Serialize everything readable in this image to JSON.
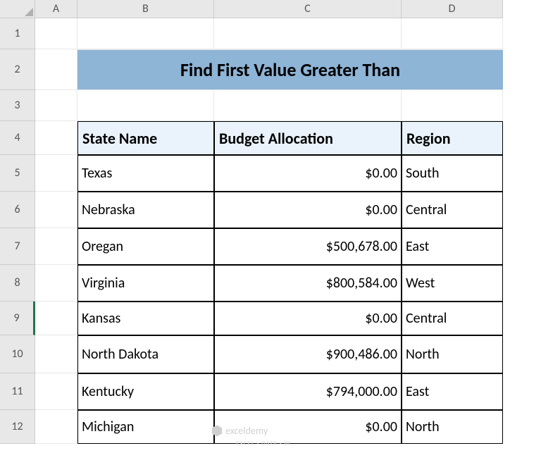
{
  "columns": [
    "A",
    "B",
    "C",
    "D"
  ],
  "rows": [
    "1",
    "2",
    "3",
    "4",
    "5",
    "6",
    "7",
    "8",
    "9",
    "10",
    "11",
    "12"
  ],
  "title": "Find First Value Greater Than",
  "headers": {
    "state": "State Name",
    "budget": "Budget Allocation",
    "region": "Region"
  },
  "data": [
    {
      "state": "Texas",
      "budget": "$0.00",
      "region": "South"
    },
    {
      "state": "Nebraska",
      "budget": "$0.00",
      "region": "Central"
    },
    {
      "state": "Oregan",
      "budget": "$500,678.00",
      "region": "East"
    },
    {
      "state": "Virginia",
      "budget": "$800,584.00",
      "region": "West"
    },
    {
      "state": "Kansas",
      "budget": "$0.00",
      "region": "Central"
    },
    {
      "state": "North Dakota",
      "budget": "$900,486.00",
      "region": "North"
    },
    {
      "state": "Kentucky",
      "budget": "$794,000.00",
      "region": "East"
    },
    {
      "state": "Michigan",
      "budget": "$0.00",
      "region": "North"
    }
  ],
  "watermark": {
    "name": "exceldemy",
    "tag": "EXCEL · DATA · BI"
  }
}
